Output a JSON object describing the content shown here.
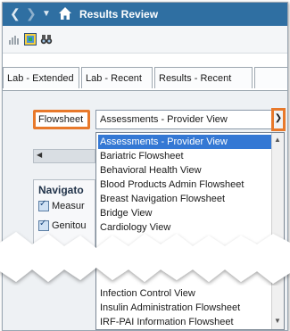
{
  "window": {
    "title": "Results Review"
  },
  "tabs": [
    "Lab - Extended",
    "Lab - Recent",
    "Results - Recent"
  ],
  "flowsheet": {
    "label": "Flowsheet",
    "selected": "Assessments - Provider View"
  },
  "navigator": {
    "title": "Navigato",
    "rows": [
      "Measur",
      "Genitou"
    ]
  },
  "dropdown": {
    "options_top": [
      "Assessments - Provider View",
      "Bariatric Flowsheet",
      "Behavioral Health View",
      "Blood Products Admin Flowsheet",
      "Breast Navigation Flowsheet",
      "Bridge View",
      "Cardiology View"
    ],
    "options_bottom": [
      "Infection Control View",
      "Insulin Administration Flowsheet",
      "IRF-PAI Information Flowsheet"
    ]
  },
  "colors": {
    "accent": "#e8792b",
    "titlebar": "#2f6fa2",
    "selection": "#3478d4"
  }
}
